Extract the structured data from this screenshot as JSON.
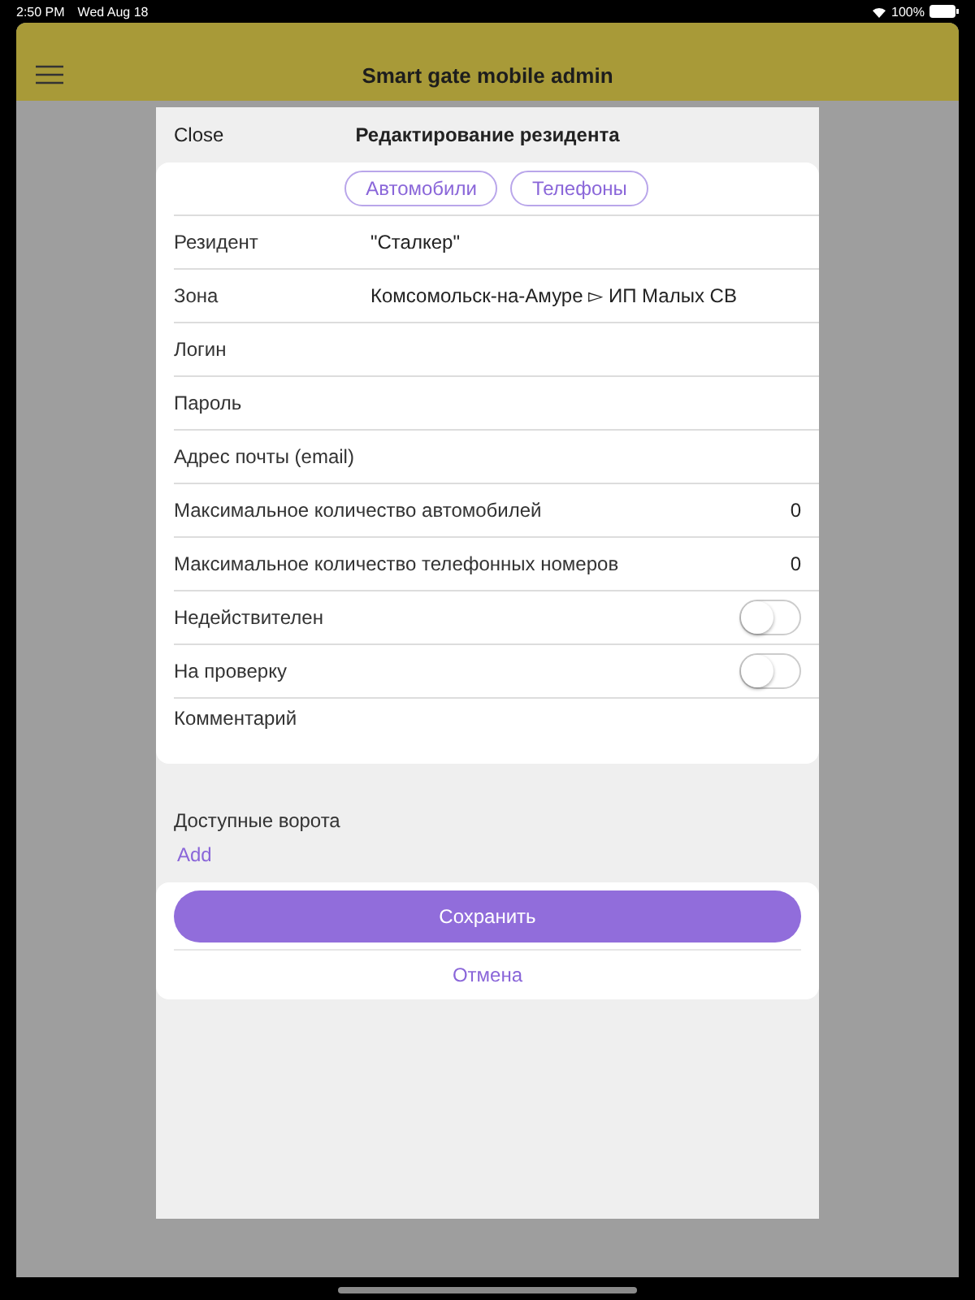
{
  "status_bar": {
    "time": "2:50 PM",
    "date": "Wed Aug 18",
    "battery": "100%"
  },
  "app_bar": {
    "title": "Smart gate mobile admin"
  },
  "dialog": {
    "close": "Close",
    "title": "Редактирование резидента",
    "tabs": [
      {
        "label": "Автомобили",
        "selected": false
      },
      {
        "label": "Телефоны",
        "selected": false
      }
    ],
    "fields": [
      {
        "kind": "text",
        "label": "Резидент",
        "value": "\"Сталкер\""
      },
      {
        "kind": "text",
        "label": "Зона",
        "value": "Комсомольск-на-Амуре ▻ ИП Малых СВ"
      },
      {
        "kind": "text",
        "label": "Логин"
      },
      {
        "kind": "text",
        "label": "Пароль"
      },
      {
        "kind": "text",
        "label": "Адрес почты (email)"
      },
      {
        "kind": "number",
        "label": "Максимальное количество автомобилей",
        "value": "0"
      },
      {
        "kind": "number",
        "label": "Максимальное количество телефонных номеров",
        "value": "0"
      },
      {
        "kind": "toggle",
        "label": "Недействителен",
        "on": false
      },
      {
        "kind": "toggle",
        "label": "На проверку",
        "on": false
      },
      {
        "kind": "comment",
        "label": "Комментарий"
      }
    ],
    "gates": {
      "label": "Доступные ворота",
      "add": "Add"
    },
    "save": "Сохранить",
    "cancel": "Отмена"
  }
}
